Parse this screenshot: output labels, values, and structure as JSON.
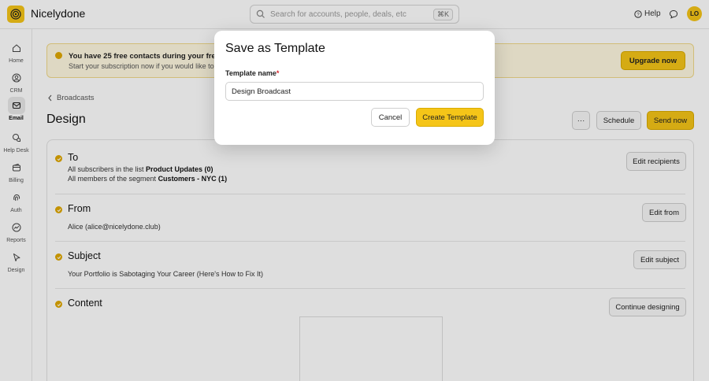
{
  "app": {
    "name": "Nicelydone",
    "avatar_initials": "LO"
  },
  "search": {
    "placeholder": "Search for accounts, people, deals, etc",
    "shortcut": "⌘K"
  },
  "header": {
    "help_label": "Help"
  },
  "sidebar": {
    "items": [
      {
        "label": "Home",
        "icon": "home-icon"
      },
      {
        "label": "CRM",
        "icon": "user-circle-icon"
      },
      {
        "label": "Email",
        "icon": "mail-icon",
        "active": true
      },
      {
        "label": "Help Desk",
        "icon": "chat-bubbles-icon"
      },
      {
        "label": "Billing",
        "icon": "wallet-icon"
      },
      {
        "label": "Auth",
        "icon": "fingerprint-icon"
      },
      {
        "label": "Reports",
        "icon": "chart-icon"
      },
      {
        "label": "Design",
        "icon": "pointer-icon"
      }
    ]
  },
  "banner": {
    "title": "You have 25 free contacts during your free trial.",
    "subtitle": "Start your subscription now if you would like to increase this limit.",
    "button": "Upgrade now"
  },
  "breadcrumb": {
    "label": "Broadcasts"
  },
  "page": {
    "title": "Design",
    "more_label": "···",
    "schedule_label": "Schedule",
    "send_label": "Send now"
  },
  "sections": {
    "to": {
      "title": "To",
      "line1_prefix": "All subscribers in the list ",
      "line1_value": "Product Updates (0)",
      "line2_prefix": "All members of the segment ",
      "line2_value": "Customers - NYC (1)",
      "button": "Edit recipients"
    },
    "from": {
      "title": "From",
      "value": "Alice (alice@nicelydone.club)",
      "button": "Edit from"
    },
    "subject": {
      "title": "Subject",
      "value": "Your Portfolio is Sabotaging Your Career (Here's How to Fix It)",
      "button": "Edit subject"
    },
    "content": {
      "title": "Content",
      "button": "Continue designing"
    }
  },
  "modal": {
    "title": "Save as Template",
    "field_label": "Template name",
    "required_mark": "*",
    "field_value": "Design Broadcast",
    "cancel": "Cancel",
    "create": "Create Template"
  },
  "colors": {
    "accent": "#f5c518",
    "banner_bg": "#fff8e1",
    "check": "#e0a800"
  }
}
